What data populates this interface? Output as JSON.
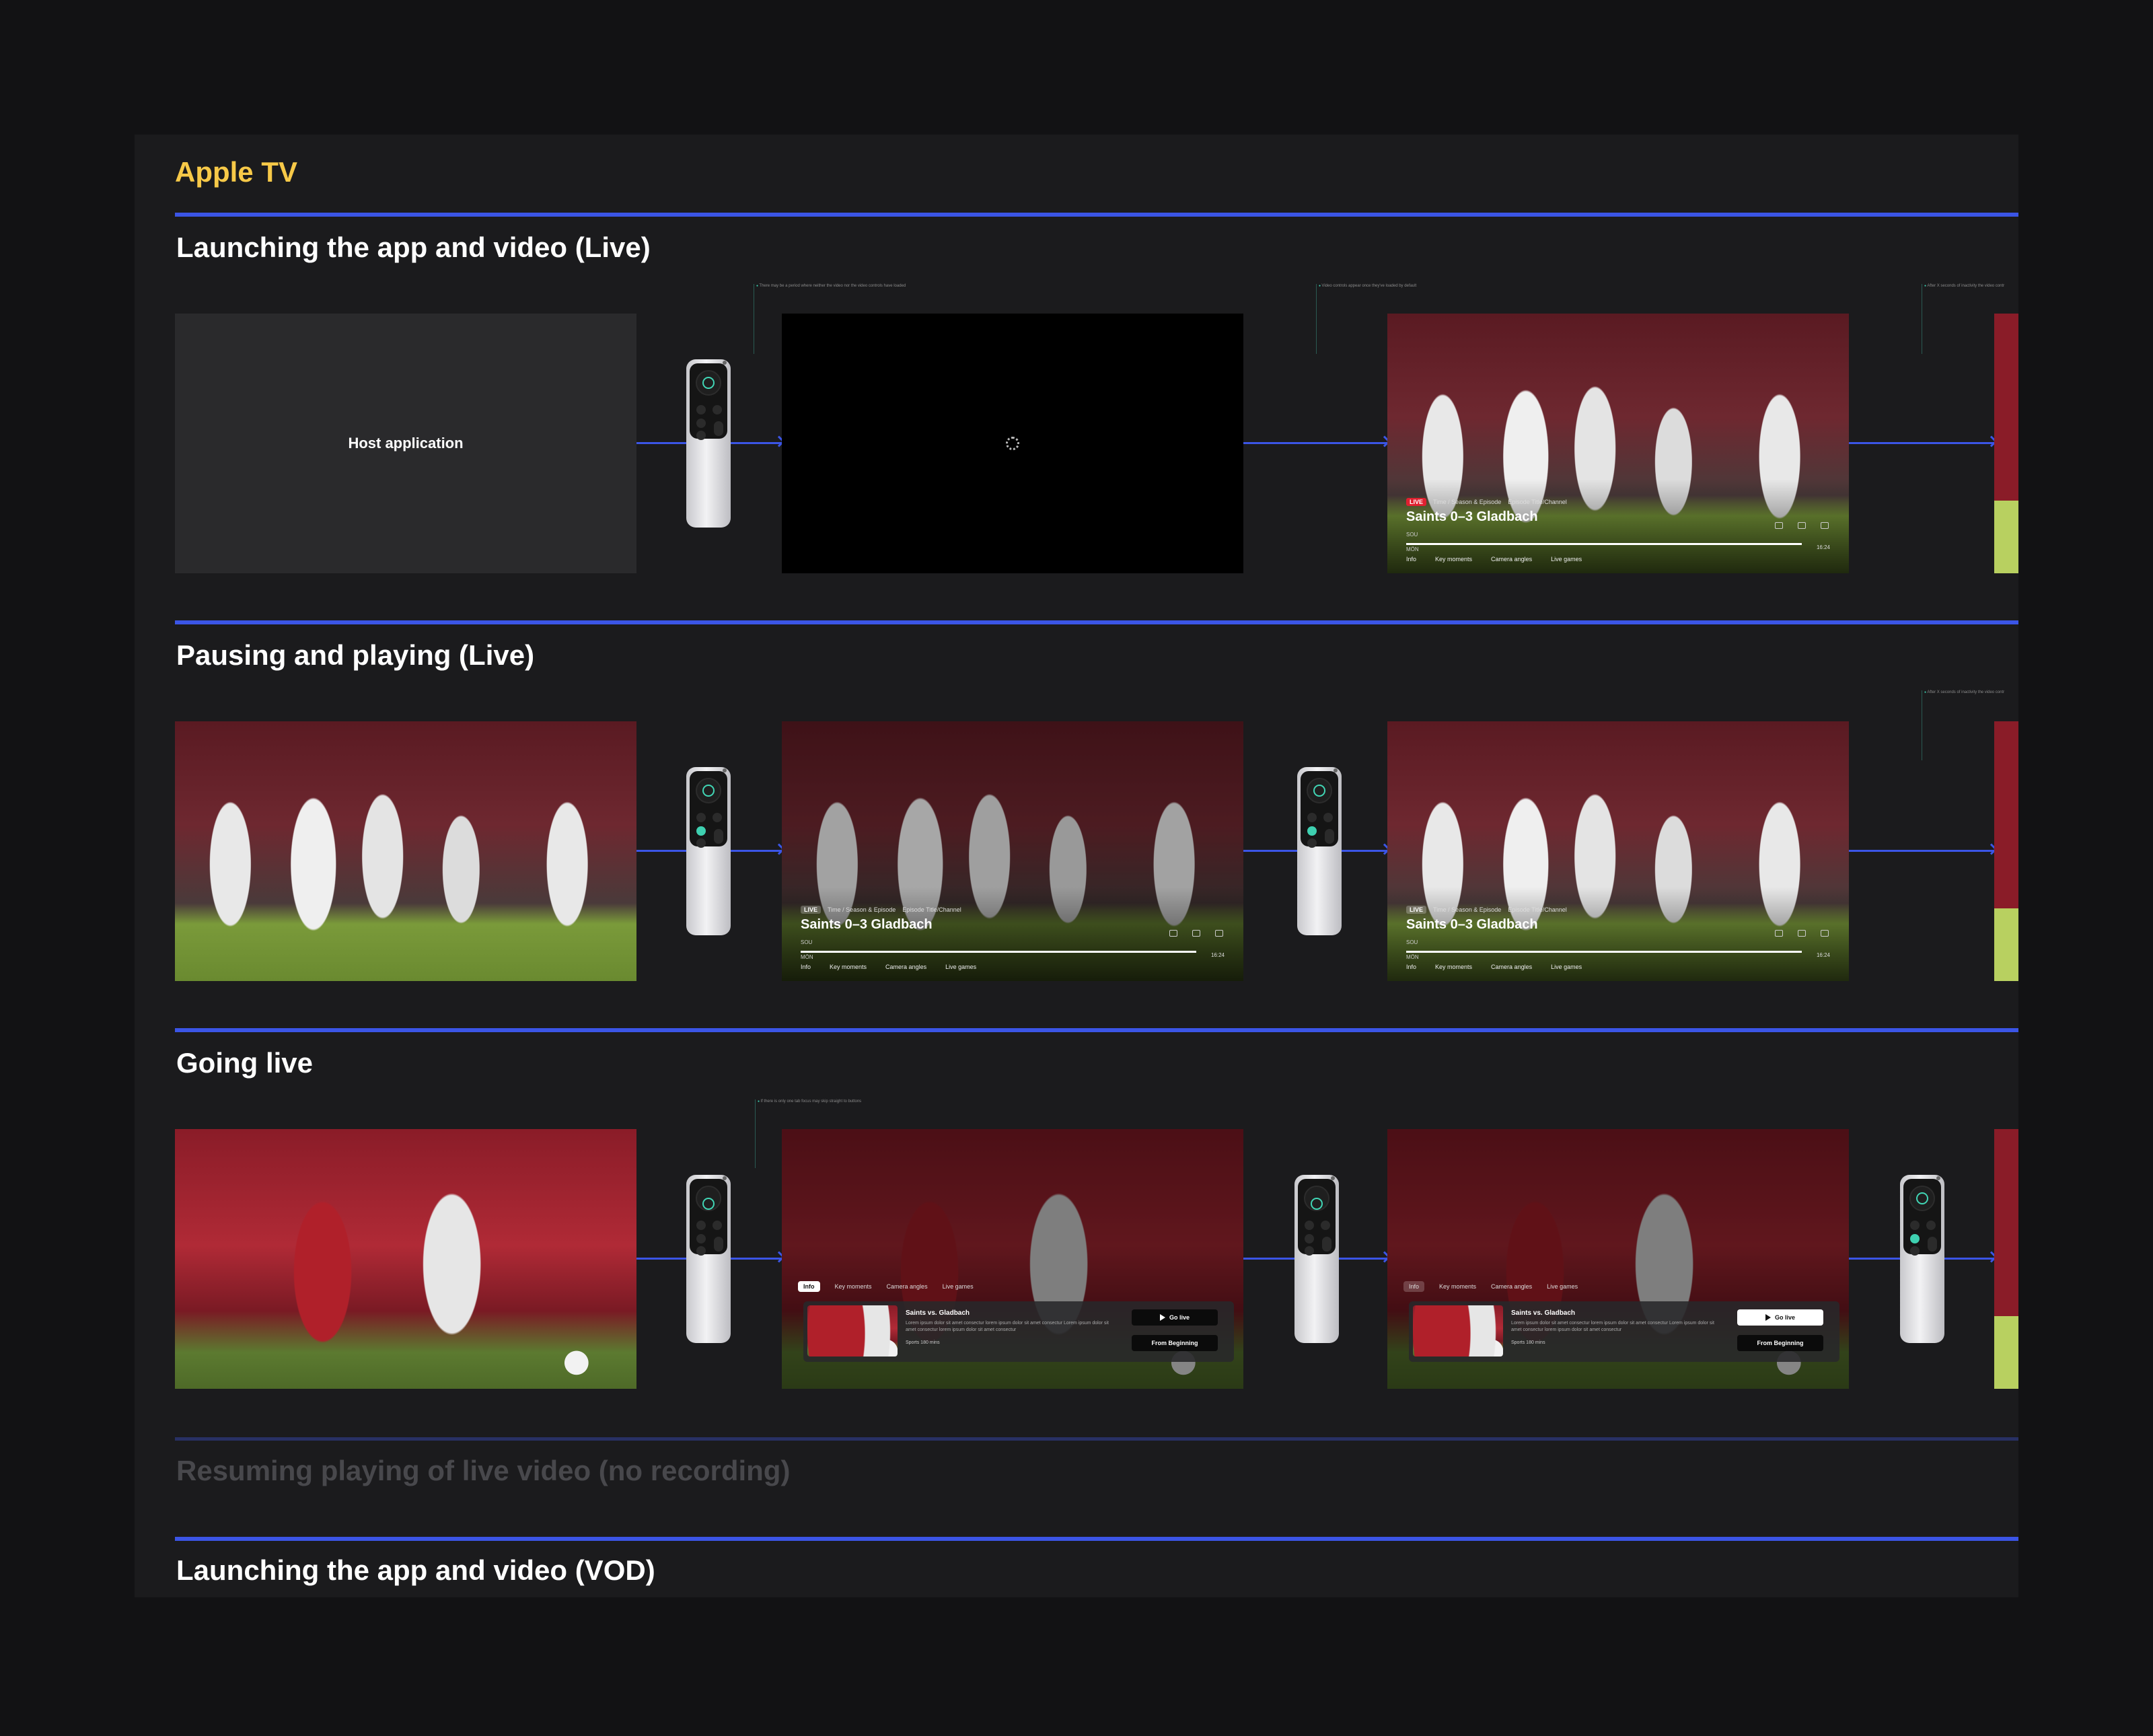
{
  "board": {
    "title": "Apple TV"
  },
  "sections": [
    {
      "title": "Launching the app and video (Live)"
    },
    {
      "title": "Pausing and playing (Live)"
    },
    {
      "title": "Going live"
    },
    {
      "title": "Resuming playing of live video (no recording)"
    },
    {
      "title": "Launching the app and video (VOD)"
    }
  ],
  "host": {
    "label": "Host application"
  },
  "notes": {
    "n1": "There may be a period where neither the video nor the video controls have loaded",
    "n2": "Video controls appear once they've loaded by default",
    "n3": "After X seconds of inactivity the video contr",
    "n4": "After X seconds of inactivity the video contr",
    "n5": "If there is only one tab focus may skip straight to buttons"
  },
  "player": {
    "live_badge": "LIVE",
    "meta": "Time / Season & Episode",
    "meta2": "Episode Title/Channel",
    "title": "Saints 0–3 Gladbach",
    "home": "SOU",
    "away": "MÖN",
    "time": "16:24",
    "tabs": [
      "Info",
      "Key moments",
      "Camera angles",
      "Live games"
    ]
  },
  "info_panel": {
    "tabs": [
      "Info",
      "Key moments",
      "Camera angles",
      "Live games"
    ],
    "name": "Saints vs. Gladbach",
    "description": "Lorem ipsum dolor sit amet consectur lorem ipsum dolor sit amet consectur Lorem ipsum dolor sit amet consectur lorem ipsum dolor sit amet consectur",
    "subline": "Sports 180 mins",
    "go_live": "Go live",
    "from_beginning": "From Beginning"
  },
  "colors": {
    "accent_title": "#f7c948",
    "flow_arrow": "#3b55e6",
    "remote_highlight": "#3ed0b0",
    "live_red": "#e02030"
  }
}
